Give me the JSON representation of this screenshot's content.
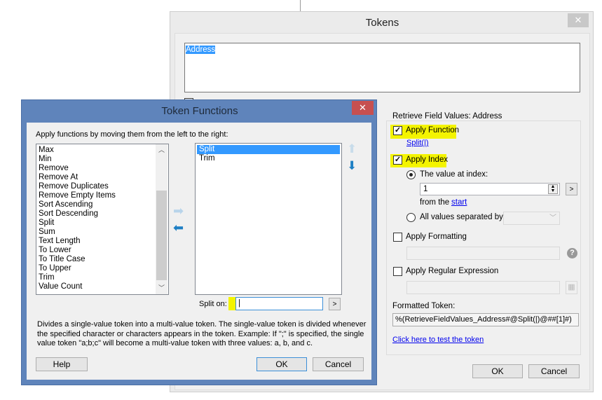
{
  "tokens_window": {
    "title": "Tokens",
    "token_text": "Address",
    "group_title": "Retrieve Field Values: Address",
    "apply_function": {
      "label": "Apply Function",
      "checked": true,
      "link": "Split(|)"
    },
    "apply_index": {
      "label": "Apply Index",
      "checked": true
    },
    "value_at_index": {
      "label": "The value at index:",
      "selected": true,
      "value": "1",
      "from_label": "from the",
      "from_link": "start",
      "go_label": ">"
    },
    "all_values": {
      "label": "All values separated by:",
      "selected": false,
      "value": ""
    },
    "apply_formatting": {
      "label": "Apply Formatting",
      "checked": false
    },
    "apply_regex": {
      "label": "Apply Regular Expression",
      "checked": false
    },
    "formatted_token_label": "Formatted Token:",
    "formatted_token": "%(RetrieveFieldValues_Address#@Split(|)@##[1]#)",
    "test_link": "Click here to test the token",
    "ok": "OK",
    "cancel": "Cancel"
  },
  "token_functions": {
    "title": "Token Functions",
    "instruction": "Apply functions by moving them from the left to the right:",
    "available": [
      "Max",
      "Min",
      "Remove",
      "Remove At",
      "Remove Duplicates",
      "Remove Empty Items",
      "Sort Ascending",
      "Sort Descending",
      "Split",
      "Sum",
      "Text Length",
      "To Lower",
      "To Title Case",
      "To Upper",
      "Trim",
      "Value Count"
    ],
    "applied": [
      "Split",
      "Trim"
    ],
    "selected_applied": "Split",
    "split_on_label": "Split on:",
    "split_on_value": "|",
    "go_label": ">",
    "description": "Divides a single-value token into a multi-value token. The single-value token is divided whenever the specified character or characters appears in the token. Example: If \";\" is specified, the single value token \"a;b;c\" will become a multi-value token with three values: a, b, and c.",
    "help": "Help",
    "ok": "OK",
    "cancel": "Cancel"
  },
  "colors": {
    "title_active": "#5f84bb",
    "close_red": "#c75050",
    "selection": "#3399ff",
    "highlight": "#f4f400"
  }
}
